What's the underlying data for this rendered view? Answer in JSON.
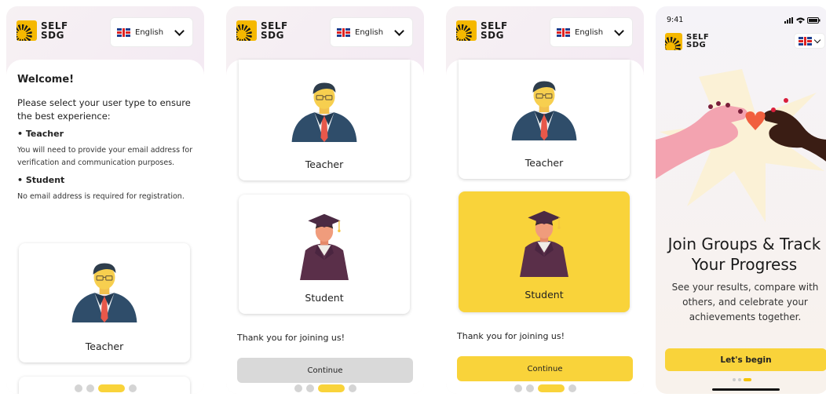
{
  "brand": {
    "line1": "SELF",
    "line2": "SDG"
  },
  "language": {
    "selected": "English"
  },
  "screen1": {
    "heading": "Welcome!",
    "lead": "Please select your user type to ensure the best experience:",
    "teacher_bullet": "• Teacher",
    "teacher_note": "You will need to provide your email address for verification and communication purposes.",
    "student_bullet": "• Student",
    "student_note": "No email address is required for registration.",
    "card_teacher": "Teacher"
  },
  "screen2": {
    "card_teacher": "Teacher",
    "card_student": "Student",
    "thanks": "Thank you for joining us!",
    "continue": "Continue"
  },
  "screen3": {
    "card_teacher": "Teacher",
    "card_student": "Student",
    "thanks": "Thank you for joining us!",
    "continue": "Continue"
  },
  "screen4": {
    "time": "9:41",
    "title": "Join Groups & Track Your Progress",
    "subtitle": "See your results, compare with others, and celebrate your achievements together.",
    "cta": "Let's begin"
  },
  "colors": {
    "accent": "#f9d33a",
    "logo": "#f5b800",
    "disabled": "#d9d9d9"
  }
}
